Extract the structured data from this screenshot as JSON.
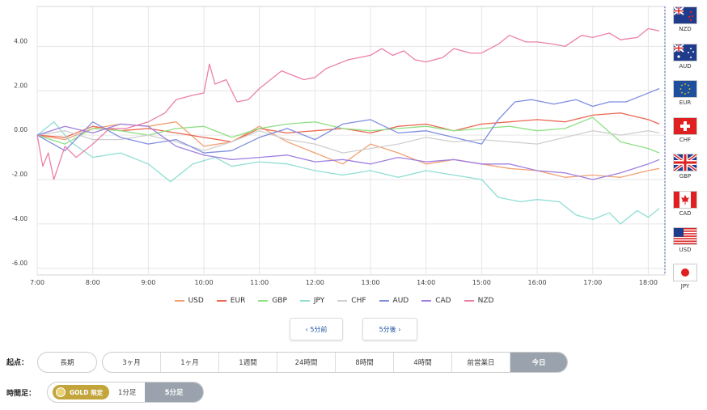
{
  "chart_data": {
    "type": "line",
    "x_labels": [
      "7:00",
      "8:00",
      "9:00",
      "10:00",
      "11:00",
      "12:00",
      "13:00",
      "14:00",
      "15:00",
      "16:00",
      "17:00",
      "18:00"
    ],
    "y_ticks": [
      "4.00",
      "2.00",
      "0.00",
      "-2.00",
      "-4.00",
      "-6.00"
    ],
    "y_tick_values": [
      4,
      2,
      0,
      -2,
      -4,
      -6
    ],
    "ylim": [
      -6.3,
      5.8
    ],
    "xlim": [
      7.0,
      18.3
    ],
    "series": [
      {
        "name": "USD",
        "color": "#f2a173",
        "points": [
          [
            7.0,
            0.0
          ],
          [
            7.5,
            -0.2
          ],
          [
            8.0,
            0.3
          ],
          [
            8.5,
            0.5
          ],
          [
            9.0,
            0.4
          ],
          [
            9.5,
            0.6
          ],
          [
            10.0,
            -0.5
          ],
          [
            10.5,
            -0.3
          ],
          [
            11.0,
            0.4
          ],
          [
            11.5,
            -0.3
          ],
          [
            12.0,
            -0.8
          ],
          [
            12.5,
            -1.3
          ],
          [
            13.0,
            -0.4
          ],
          [
            13.5,
            -0.8
          ],
          [
            14.0,
            -1.3
          ],
          [
            14.5,
            -1.1
          ],
          [
            15.0,
            -1.3
          ],
          [
            15.5,
            -1.5
          ],
          [
            16.0,
            -1.6
          ],
          [
            16.5,
            -1.9
          ],
          [
            17.0,
            -1.8
          ],
          [
            17.5,
            -1.9
          ],
          [
            18.0,
            -1.6
          ],
          [
            18.2,
            -1.5
          ]
        ]
      },
      {
        "name": "EUR",
        "color": "#ea6750",
        "points": [
          [
            7.0,
            0.0
          ],
          [
            7.5,
            -0.1
          ],
          [
            8.0,
            0.4
          ],
          [
            8.5,
            0.2
          ],
          [
            9.0,
            0.3
          ],
          [
            9.5,
            0.1
          ],
          [
            10.0,
            -0.1
          ],
          [
            10.5,
            -0.3
          ],
          [
            11.0,
            0.3
          ],
          [
            11.5,
            0.1
          ],
          [
            12.0,
            0.2
          ],
          [
            12.5,
            0.3
          ],
          [
            13.0,
            0.1
          ],
          [
            13.5,
            0.4
          ],
          [
            14.0,
            0.5
          ],
          [
            14.5,
            0.2
          ],
          [
            15.0,
            0.5
          ],
          [
            15.5,
            0.6
          ],
          [
            16.0,
            0.7
          ],
          [
            16.5,
            0.6
          ],
          [
            17.0,
            0.9
          ],
          [
            17.5,
            1.0
          ],
          [
            18.0,
            0.7
          ],
          [
            18.2,
            0.5
          ]
        ]
      },
      {
        "name": "GBP",
        "color": "#8ee085",
        "points": [
          [
            7.0,
            0.0
          ],
          [
            7.5,
            -0.4
          ],
          [
            8.0,
            0.3
          ],
          [
            8.5,
            0.2
          ],
          [
            9.0,
            0.0
          ],
          [
            9.5,
            0.3
          ],
          [
            10.0,
            0.4
          ],
          [
            10.5,
            -0.1
          ],
          [
            11.0,
            0.3
          ],
          [
            11.5,
            0.5
          ],
          [
            12.0,
            0.6
          ],
          [
            12.5,
            0.3
          ],
          [
            13.0,
            0.2
          ],
          [
            13.5,
            0.3
          ],
          [
            14.0,
            0.4
          ],
          [
            14.5,
            0.2
          ],
          [
            15.0,
            0.3
          ],
          [
            15.5,
            0.4
          ],
          [
            16.0,
            0.2
          ],
          [
            16.5,
            0.3
          ],
          [
            17.0,
            0.8
          ],
          [
            17.5,
            -0.3
          ],
          [
            18.0,
            -0.6
          ],
          [
            18.2,
            -0.8
          ]
        ]
      },
      {
        "name": "JPY",
        "color": "#8fded4",
        "points": [
          [
            7.0,
            0.0
          ],
          [
            7.3,
            0.6
          ],
          [
            7.6,
            -0.3
          ],
          [
            8.0,
            -1.0
          ],
          [
            8.5,
            -0.8
          ],
          [
            9.0,
            -1.3
          ],
          [
            9.4,
            -2.1
          ],
          [
            9.8,
            -1.3
          ],
          [
            10.2,
            -1.0
          ],
          [
            10.5,
            -1.4
          ],
          [
            11.0,
            -1.2
          ],
          [
            11.5,
            -1.3
          ],
          [
            12.0,
            -1.6
          ],
          [
            12.5,
            -1.8
          ],
          [
            13.0,
            -1.6
          ],
          [
            13.5,
            -1.9
          ],
          [
            14.0,
            -1.6
          ],
          [
            14.5,
            -1.8
          ],
          [
            15.0,
            -2.0
          ],
          [
            15.3,
            -2.8
          ],
          [
            15.7,
            -3.0
          ],
          [
            16.0,
            -2.9
          ],
          [
            16.4,
            -3.0
          ],
          [
            16.7,
            -3.6
          ],
          [
            17.0,
            -3.8
          ],
          [
            17.3,
            -3.5
          ],
          [
            17.5,
            -4.0
          ],
          [
            17.8,
            -3.4
          ],
          [
            18.0,
            -3.7
          ],
          [
            18.2,
            -3.3
          ]
        ]
      },
      {
        "name": "CHF",
        "color": "#cfcfcf",
        "points": [
          [
            7.0,
            0.0
          ],
          [
            7.5,
            0.2
          ],
          [
            8.0,
            -0.2
          ],
          [
            8.5,
            -0.2
          ],
          [
            9.0,
            0.0
          ],
          [
            9.5,
            -0.3
          ],
          [
            10.0,
            -0.7
          ],
          [
            10.5,
            -0.3
          ],
          [
            11.0,
            0.2
          ],
          [
            11.5,
            -0.2
          ],
          [
            12.0,
            -0.4
          ],
          [
            12.5,
            -0.8
          ],
          [
            13.0,
            -0.6
          ],
          [
            13.5,
            -0.4
          ],
          [
            14.0,
            -0.1
          ],
          [
            14.5,
            -0.3
          ],
          [
            15.0,
            -0.2
          ],
          [
            15.5,
            -0.3
          ],
          [
            16.0,
            -0.4
          ],
          [
            16.5,
            -0.1
          ],
          [
            17.0,
            0.2
          ],
          [
            17.5,
            0.0
          ],
          [
            18.0,
            0.2
          ],
          [
            18.2,
            0.1
          ]
        ]
      },
      {
        "name": "AUD",
        "color": "#7f8fe0",
        "points": [
          [
            7.0,
            0.0
          ],
          [
            7.5,
            -0.7
          ],
          [
            8.0,
            0.6
          ],
          [
            8.5,
            -0.1
          ],
          [
            9.0,
            -0.4
          ],
          [
            9.5,
            -0.2
          ],
          [
            10.0,
            -0.8
          ],
          [
            10.5,
            -0.7
          ],
          [
            11.0,
            -0.1
          ],
          [
            11.5,
            0.3
          ],
          [
            12.0,
            -0.2
          ],
          [
            12.5,
            0.5
          ],
          [
            13.0,
            0.7
          ],
          [
            13.5,
            0.1
          ],
          [
            14.0,
            0.2
          ],
          [
            14.5,
            -0.1
          ],
          [
            15.0,
            -0.4
          ],
          [
            15.3,
            0.7
          ],
          [
            15.6,
            1.5
          ],
          [
            15.9,
            1.6
          ],
          [
            16.3,
            1.4
          ],
          [
            16.7,
            1.6
          ],
          [
            17.0,
            1.3
          ],
          [
            17.3,
            1.5
          ],
          [
            17.6,
            1.5
          ],
          [
            17.9,
            1.8
          ],
          [
            18.2,
            2.1
          ]
        ]
      },
      {
        "name": "CAD",
        "color": "#a180e0",
        "points": [
          [
            7.0,
            0.0
          ],
          [
            7.5,
            0.4
          ],
          [
            8.0,
            0.1
          ],
          [
            8.5,
            0.5
          ],
          [
            9.0,
            0.4
          ],
          [
            9.5,
            -0.5
          ],
          [
            10.0,
            -0.9
          ],
          [
            10.5,
            -1.1
          ],
          [
            11.0,
            -1.0
          ],
          [
            11.5,
            -0.9
          ],
          [
            12.0,
            -1.2
          ],
          [
            12.5,
            -1.1
          ],
          [
            13.0,
            -1.3
          ],
          [
            13.5,
            -1.0
          ],
          [
            14.0,
            -1.2
          ],
          [
            14.5,
            -1.1
          ],
          [
            15.0,
            -1.3
          ],
          [
            15.5,
            -1.3
          ],
          [
            16.0,
            -1.6
          ],
          [
            16.5,
            -1.7
          ],
          [
            17.0,
            -2.0
          ],
          [
            17.5,
            -1.7
          ],
          [
            18.0,
            -1.3
          ],
          [
            18.2,
            -1.1
          ]
        ]
      },
      {
        "name": "NZD",
        "color": "#ec7faa",
        "points": [
          [
            7.0,
            0.0
          ],
          [
            7.1,
            -1.4
          ],
          [
            7.2,
            -0.8
          ],
          [
            7.3,
            -2.0
          ],
          [
            7.5,
            -0.5
          ],
          [
            7.7,
            -1.0
          ],
          [
            8.0,
            -0.4
          ],
          [
            8.3,
            0.3
          ],
          [
            8.6,
            0.3
          ],
          [
            9.0,
            0.6
          ],
          [
            9.3,
            1.0
          ],
          [
            9.5,
            1.6
          ],
          [
            9.8,
            1.8
          ],
          [
            10.0,
            1.9
          ],
          [
            10.1,
            3.2
          ],
          [
            10.2,
            2.3
          ],
          [
            10.4,
            2.5
          ],
          [
            10.6,
            1.5
          ],
          [
            10.8,
            1.6
          ],
          [
            11.0,
            2.1
          ],
          [
            11.2,
            2.5
          ],
          [
            11.4,
            2.9
          ],
          [
            11.6,
            2.7
          ],
          [
            11.8,
            2.5
          ],
          [
            12.0,
            2.6
          ],
          [
            12.2,
            3.0
          ],
          [
            12.4,
            3.2
          ],
          [
            12.6,
            3.4
          ],
          [
            12.8,
            3.5
          ],
          [
            13.0,
            3.6
          ],
          [
            13.2,
            3.9
          ],
          [
            13.4,
            3.6
          ],
          [
            13.6,
            3.8
          ],
          [
            13.8,
            3.4
          ],
          [
            14.0,
            3.3
          ],
          [
            14.3,
            3.5
          ],
          [
            14.5,
            3.9
          ],
          [
            14.8,
            3.7
          ],
          [
            15.0,
            3.7
          ],
          [
            15.3,
            4.1
          ],
          [
            15.5,
            4.5
          ],
          [
            15.8,
            4.2
          ],
          [
            16.0,
            4.2
          ],
          [
            16.3,
            4.1
          ],
          [
            16.5,
            4.0
          ],
          [
            16.8,
            4.5
          ],
          [
            17.0,
            4.4
          ],
          [
            17.3,
            4.6
          ],
          [
            17.5,
            4.3
          ],
          [
            17.8,
            4.4
          ],
          [
            18.0,
            4.8
          ],
          [
            18.2,
            4.7
          ]
        ]
      }
    ],
    "grid": true
  },
  "currency_flags": [
    {
      "code": "NZD",
      "icon": "nz-flag-icon"
    },
    {
      "code": "AUD",
      "icon": "au-flag-icon"
    },
    {
      "code": "EUR",
      "icon": "eu-flag-icon"
    },
    {
      "code": "CHF",
      "icon": "ch-flag-icon"
    },
    {
      "code": "GBP",
      "icon": "gb-flag-icon"
    },
    {
      "code": "CAD",
      "icon": "ca-flag-icon"
    },
    {
      "code": "USD",
      "icon": "us-flag-icon"
    },
    {
      "code": "JPY",
      "icon": "jp-flag-icon"
    }
  ],
  "nav": {
    "prev_label": "‹ 5分前",
    "next_label": "5分後 ›"
  },
  "start_point": {
    "label": "起点：",
    "long_label": "長期",
    "options": [
      "3ヶ月",
      "1ヶ月",
      "1週間",
      "24時間",
      "8時間",
      "4時間",
      "前営業日",
      "今日"
    ],
    "selected": "今日"
  },
  "timeframe": {
    "label": "時間足：",
    "gold_label": "GOLD 限定",
    "options": [
      "1分足",
      "5分足"
    ],
    "selected": "5分足"
  }
}
